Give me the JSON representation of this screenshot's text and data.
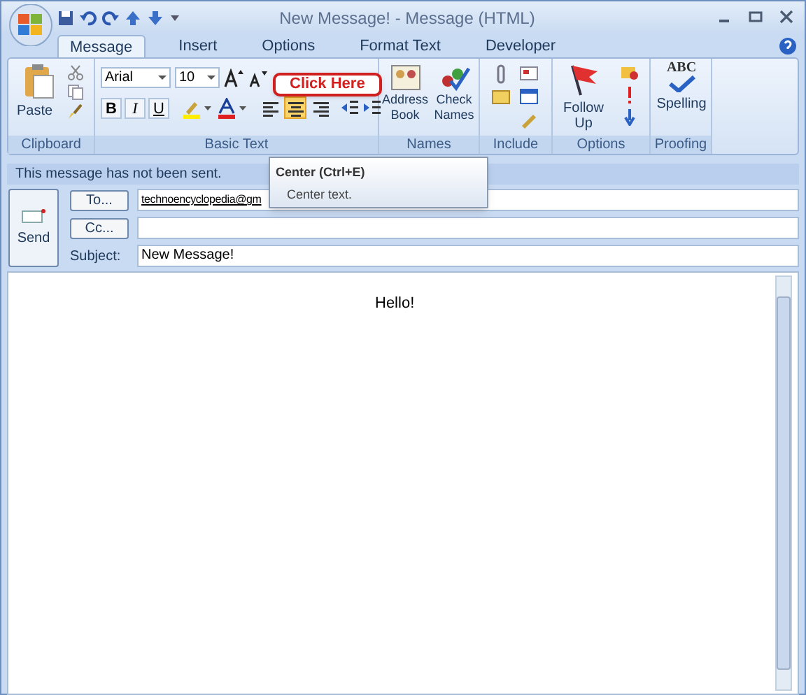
{
  "window": {
    "title": "New Message! - Message (HTML)"
  },
  "tabs": [
    {
      "label": "Message",
      "selected": true
    },
    {
      "label": "Insert",
      "selected": false
    },
    {
      "label": "Options",
      "selected": false
    },
    {
      "label": "Format Text",
      "selected": false
    },
    {
      "label": "Developer",
      "selected": false
    }
  ],
  "ribbon": {
    "clipboard": {
      "label": "Clipboard",
      "paste": "Paste"
    },
    "basic_text": {
      "label": "Basic Text",
      "font": "Arial",
      "size": "10",
      "format_buttons": [
        "B",
        "I",
        "U"
      ],
      "align_buttons": [
        {
          "kind": "left",
          "selected": false
        },
        {
          "kind": "center",
          "selected": true
        },
        {
          "kind": "right",
          "selected": false
        }
      ]
    },
    "names": {
      "label": "Names",
      "buttons": [
        "Address Book",
        "Check Names"
      ]
    },
    "include": {
      "label": "Include"
    },
    "options": {
      "label": "Options",
      "follow_up": "Follow Up"
    },
    "proofing": {
      "label": "Proofing",
      "spelling": "Spelling",
      "icon_text": "ABC"
    }
  },
  "callout": "Click Here",
  "tooltip": {
    "title": "Center (Ctrl+E)",
    "description": "Center text."
  },
  "info_bar": "This message has not been sent.",
  "send_button": "Send",
  "fields": [
    {
      "kind": "button",
      "label": "To...",
      "value": "technoencyclopedia@gm"
    },
    {
      "kind": "button",
      "label": "Cc..."
    },
    {
      "kind": "text",
      "label": "Subject:",
      "value": "New Message!"
    }
  ],
  "body": "Hello!"
}
